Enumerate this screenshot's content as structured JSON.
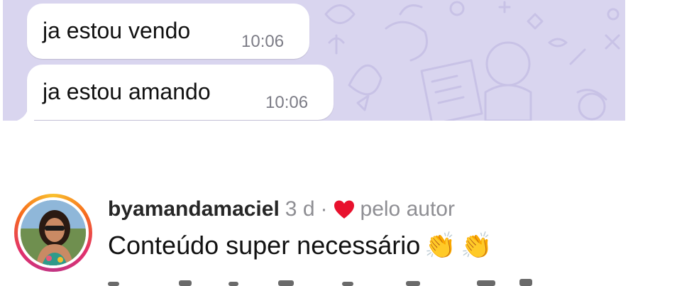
{
  "chat": {
    "messages": [
      {
        "text": "ja estou vendo",
        "time": "10:06"
      },
      {
        "text": "ja estou amando",
        "time": "10:06"
      }
    ]
  },
  "comment": {
    "username": "byamandamaciel",
    "age": "3 d",
    "separator": "·",
    "liked_by": "pelo autor",
    "text": "Conteúdo super necessário",
    "emoji": [
      "👏",
      "👏"
    ]
  },
  "colors": {
    "chat_background": "#d9d5ef",
    "heart": "#e8112d",
    "time_text": "#7c7c86",
    "meta_text": "#8e8e93"
  }
}
